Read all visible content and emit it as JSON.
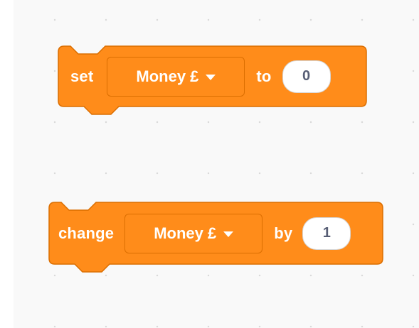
{
  "workspace": {
    "blocks": [
      {
        "id": "set-variable",
        "label": "set",
        "variable": "Money £",
        "connector": "to",
        "value": "0"
      },
      {
        "id": "change-variable",
        "label": "change",
        "variable": "Money £",
        "connector": "by",
        "value": "1"
      }
    ]
  },
  "colors": {
    "block_fill": "#ff8c1a",
    "block_border": "#db6e00",
    "input_text": "#575e75",
    "canvas": "#f9f9f9"
  },
  "icons": {
    "dropdown": "caret-down-icon"
  }
}
